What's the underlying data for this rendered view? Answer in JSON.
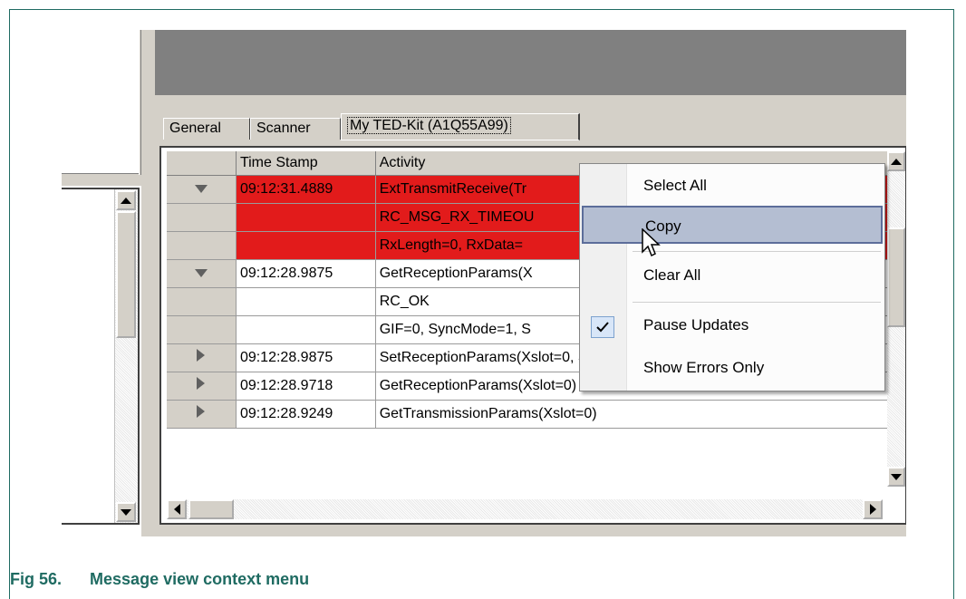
{
  "tabs": [
    {
      "label": "General"
    },
    {
      "label": "Scanner"
    },
    {
      "label": "My TED-Kit (A1Q55A99)"
    }
  ],
  "grid": {
    "columns": [
      "",
      "Time Stamp",
      "Activity"
    ],
    "rows": [
      {
        "expander": "down",
        "time": "09:12:31.4889",
        "activity": "ExtTransmitReceive(Tr",
        "error": true
      },
      {
        "expander": "",
        "time": "",
        "activity": "RC_MSG_RX_TIMEOU",
        "error": true
      },
      {
        "expander": "",
        "time": "",
        "activity": "RxLength=0, RxData=",
        "error": true
      },
      {
        "expander": "down",
        "time": "09:12:28.9875",
        "activity": "GetReceptionParams(X",
        "error": false
      },
      {
        "expander": "",
        "time": "",
        "activity": "RC_OK",
        "error": false
      },
      {
        "expander": "",
        "time": "",
        "activity": "GIF=0, SyncMode=1, S",
        "error": false
      },
      {
        "expander": "right",
        "time": "09:12:28.9875",
        "activity": "SetReceptionParams(Xslot=0, SyncMode=1, SyncTime=",
        "error": false
      },
      {
        "expander": "right",
        "time": "09:12:28.9718",
        "activity": "GetReceptionParams(Xslot=0)",
        "error": false
      },
      {
        "expander": "right",
        "time": "09:12:28.9249",
        "activity": "GetTransmissionParams(Xslot=0)",
        "error": false
      }
    ]
  },
  "context_menu": {
    "items": [
      {
        "label": "Select All",
        "checked": false,
        "hover": false
      },
      {
        "label": "Copy",
        "checked": false,
        "hover": true
      },
      {
        "label": "Clear All",
        "checked": false,
        "hover": false
      },
      {
        "label": "Pause Updates",
        "checked": true,
        "hover": false
      },
      {
        "label": "Show Errors Only",
        "checked": false,
        "hover": false
      }
    ]
  },
  "caption": {
    "figure": "Fig 56.",
    "title": "Message view context menu"
  },
  "colors": {
    "error_row": "#e21b1b",
    "caption": "#1f6b62",
    "menu_highlight": "#b4bed2"
  }
}
